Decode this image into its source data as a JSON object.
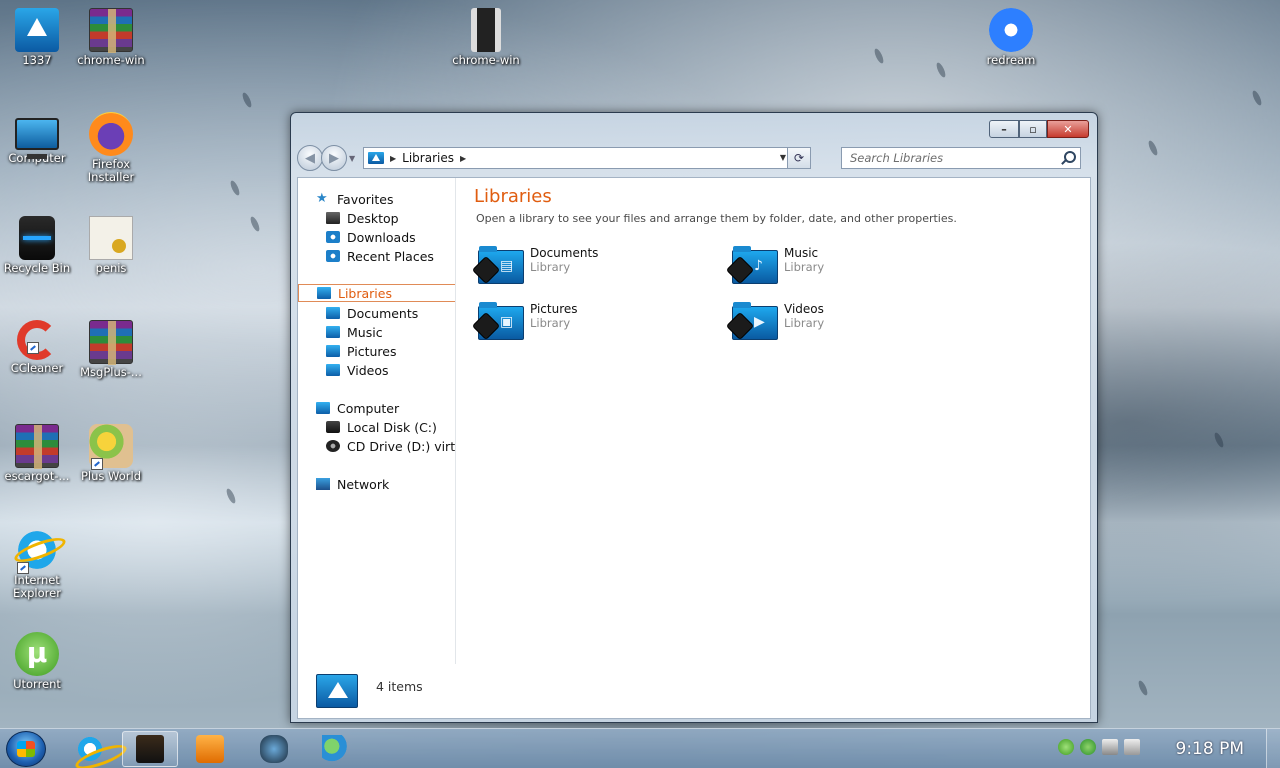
{
  "desktop": {
    "icons": [
      {
        "label": "1337",
        "icon": "acronis-icon"
      },
      {
        "label": "chrome-win",
        "icon": "archive-icon"
      },
      {
        "label": "chrome-win",
        "icon": "app-icon"
      },
      {
        "label": "redream",
        "icon": "redream-icon"
      },
      {
        "label": "Computer",
        "icon": "computer-icon"
      },
      {
        "label": "Firefox Installer",
        "icon": "firefox-icon"
      },
      {
        "label": "Recycle Bin",
        "icon": "recycle-bin-icon"
      },
      {
        "label": "penis",
        "icon": "certificate-icon"
      },
      {
        "label": "CCleaner",
        "icon": "ccleaner-icon"
      },
      {
        "label": "MsgPlus-...",
        "icon": "archive-icon"
      },
      {
        "label": "escargot-...",
        "icon": "archive-icon"
      },
      {
        "label": "Plus World",
        "icon": "plus-world-icon"
      },
      {
        "label": "Internet Explorer",
        "icon": "internet-explorer-icon"
      },
      {
        "label": "Utorrent",
        "icon": "utorrent-icon"
      }
    ]
  },
  "window": {
    "address": {
      "crumbs": [
        "Libraries"
      ]
    },
    "search": {
      "placeholder": "Search Libraries"
    },
    "nav": {
      "favorites": "Favorites",
      "desktop": "Desktop",
      "downloads": "Downloads",
      "recent_places": "Recent Places",
      "libraries": "Libraries",
      "documents": "Documents",
      "music": "Music",
      "pictures": "Pictures",
      "videos": "Videos",
      "computer": "Computer",
      "local_disk": "Local Disk (C:)",
      "cd_drive": "CD Drive (D:) virti",
      "network": "Network"
    },
    "main": {
      "title": "Libraries",
      "subtitle": "Open a library to see your files and arrange them by folder, date, and other properties.",
      "libraries": [
        {
          "name": "Documents",
          "type": "Library"
        },
        {
          "name": "Music",
          "type": "Library"
        },
        {
          "name": "Pictures",
          "type": "Library"
        },
        {
          "name": "Videos",
          "type": "Library"
        }
      ]
    },
    "details": {
      "count": "4 items"
    }
  },
  "taskbar": {
    "clock": "9:18 PM"
  }
}
